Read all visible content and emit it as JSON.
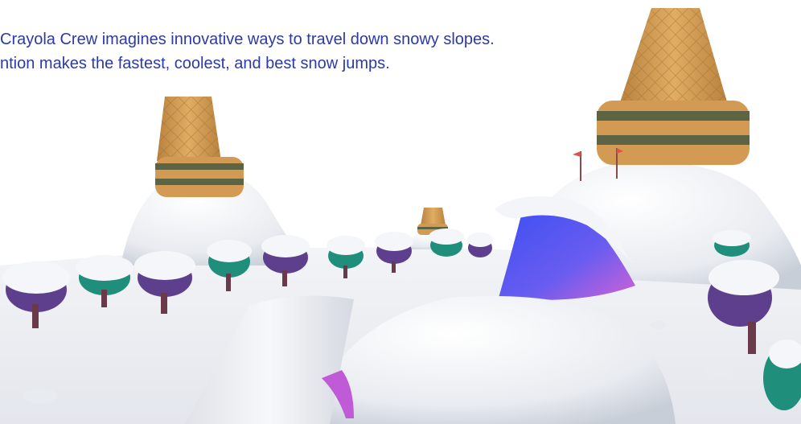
{
  "caption": {
    "line1": "Crayola Crew imagines innovative ways to travel down snowy slopes.",
    "line2": "ntion makes the fastest, coolest, and best snow jumps."
  },
  "scene": {
    "icons": [
      "ice-cream-cone-mountain-icon",
      "snow-tree-icon",
      "flag-icon",
      "ice-slide-icon",
      "snow-ramp-icon"
    ],
    "colors": {
      "caption_text": "#2b3aa7",
      "snow": "#eef0f4",
      "snow_shadow": "#c9ced8",
      "cone_light": "#d8a25a",
      "cone_dark": "#b9823e",
      "stripe_olive": "#5d6443",
      "tree_purple": "#5e3f8e",
      "tree_teal": "#1f8f7c",
      "ice_blue": "#4b5cf0",
      "ice_pink": "#c05bd8"
    }
  }
}
